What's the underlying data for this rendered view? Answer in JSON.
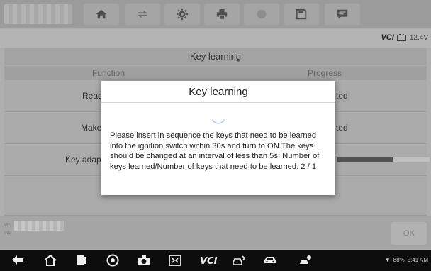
{
  "toolbar": {
    "icons": [
      "home-icon",
      "vehicle-swap-icon",
      "settings-icon",
      "print-icon",
      "help-icon",
      "save-icon",
      "message-icon"
    ]
  },
  "status": {
    "vci_label": "VCI",
    "voltage": "12.4V"
  },
  "page": {
    "title": "Key learning",
    "col_function": "Function",
    "col_progress": "Progress",
    "rows": [
      {
        "function": "Read",
        "progress": "ted"
      },
      {
        "function": "Make",
        "progress": "ted"
      },
      {
        "function": "Key adap",
        "progress_fraction": 0.6
      }
    ]
  },
  "footer": {
    "vin_label": "VIN",
    "info_label": "Info",
    "ok_label": "OK"
  },
  "dialog": {
    "title": "Key learning",
    "message": "Please insert in sequence the keys that need to be learned into the ignition switch within 30s and turn to ON.The keys should be changed at an interval of less than 5s. Number of keys learned/Number of keys that need to be learned: 2 / 1"
  },
  "system": {
    "battery": "88%",
    "time": "5:41 AM"
  }
}
